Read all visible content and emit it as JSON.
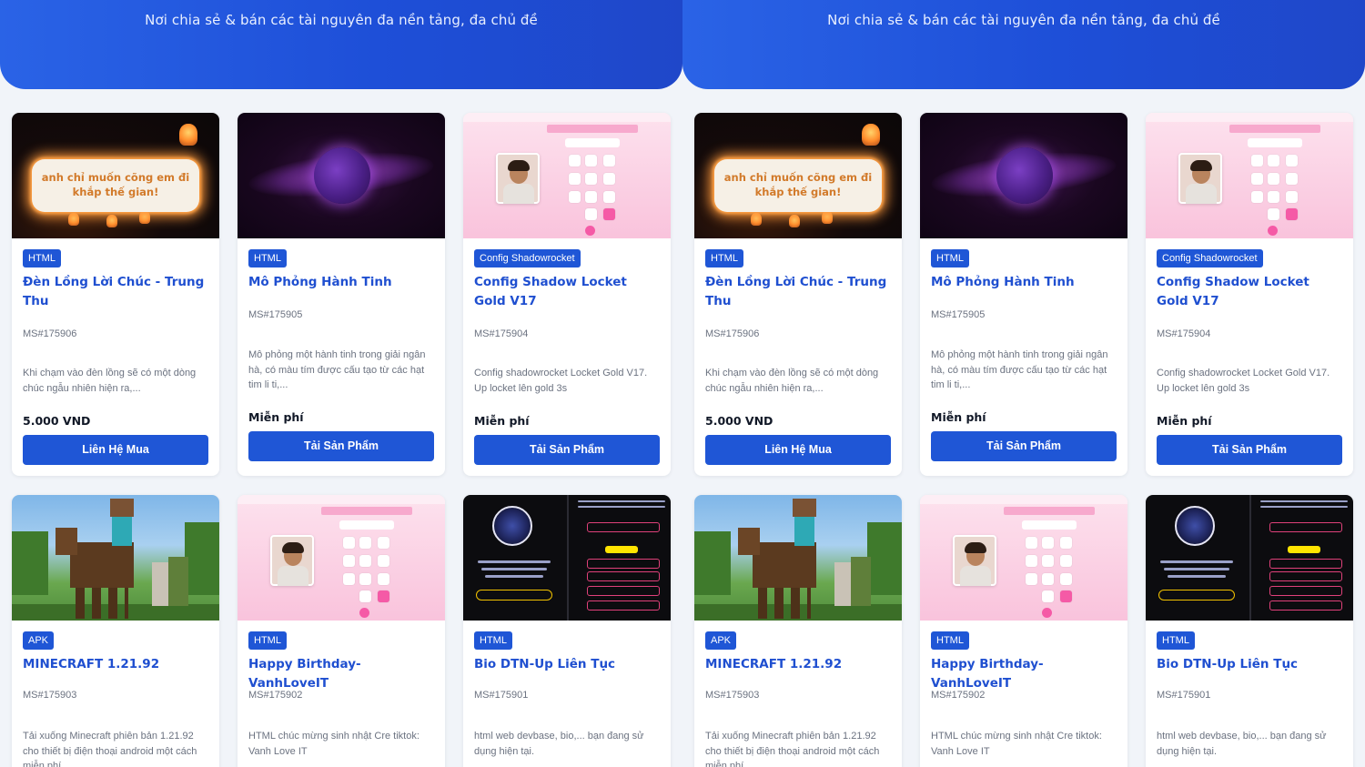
{
  "banner": {
    "tagline": "Nơi chia sẻ & bán các tài nguyên đa nền tảng, đa chủ đề"
  },
  "colors": {
    "primary": "#1f56d6",
    "title": "#1f4fd0",
    "banner_gradient": [
      "#2a63e6",
      "#1f47c9"
    ],
    "background": "#f1f4f9"
  },
  "cards": [
    {
      "category": "HTML",
      "title": "Đèn Lồng Lời Chúc - Trung Thu",
      "code": "MS#175906",
      "description": "Khi chạm vào đèn lồng sẽ có một dòng chúc ngẫu nhiên hiện ra,...",
      "price": "5.000 VND",
      "button": "Liên Hệ Mua",
      "thumb_text": "anh chỉ muốn cõng em đi khắp thế gian!"
    },
    {
      "category": "HTML",
      "title": "Mô Phỏng Hành Tinh",
      "code": "MS#175905",
      "description": "Mô phỏng một hành tinh trong giải ngân hà, có màu tím được cấu tạo từ các hạt tim li ti,...",
      "price": "Miễn phí",
      "button": "Tải Sản Phẩm"
    },
    {
      "category": "Config Shadowrocket",
      "title": "Config Shadow Locket Gold V17",
      "code": "MS#175904",
      "description": "Config shadowrocket Locket Gold V17. Up locket lên gold 3s",
      "price": "Miễn phí",
      "button": "Tải Sản Phẩm"
    },
    {
      "category": "APK",
      "title": "MINECRAFT 1.21.92",
      "code": "MS#175903",
      "description": "Tải xuống Minecraft phiên bản 1.21.92 cho thiết bị điện thoại android một cách miễn phí"
    },
    {
      "category": "HTML",
      "title": "Happy Birthday-VanhLoveIT",
      "code": "MS#175902",
      "description": "HTML chúc mừng sinh nhật Cre tiktok: Vanh Love IT"
    },
    {
      "category": "HTML",
      "title": "Bio DTN-Up Liên Tục",
      "code": "MS#175901",
      "description": "html web devbase, bio,... bạn đang sử dụng hiện tại."
    }
  ]
}
